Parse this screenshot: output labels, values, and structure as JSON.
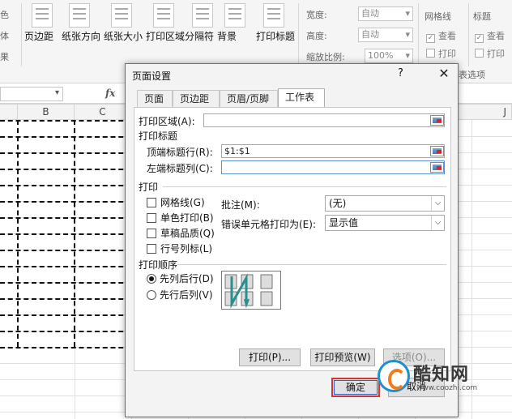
{
  "ribbon": {
    "left_partial": [
      "色",
      "体",
      "果"
    ],
    "buttons": [
      {
        "label": "页边距",
        "icon": "margins-icon"
      },
      {
        "label": "纸张方向",
        "icon": "orientation-icon"
      },
      {
        "label": "纸张大小",
        "icon": "paper-size-icon"
      },
      {
        "label": "打印区域",
        "icon": "print-area-icon"
      },
      {
        "label": "分隔符",
        "icon": "breaks-icon"
      },
      {
        "label": "背景",
        "icon": "background-icon"
      },
      {
        "label": "打印标题",
        "icon": "print-titles-icon"
      }
    ],
    "scale": {
      "width_label": "宽度:",
      "width_value": "自动",
      "height_label": "高度:",
      "height_value": "自动",
      "zoom_label": "缩放比例:",
      "zoom_value": "100%"
    },
    "gridlines": {
      "title": "网格线",
      "view": "查看",
      "print": "打印"
    },
    "headings": {
      "title": "标题",
      "view": "查看",
      "print": "打印"
    },
    "options_partial": "表选项"
  },
  "formula_bar": {
    "fx": "fx"
  },
  "columns": [
    "B",
    "C",
    "J"
  ],
  "dialog": {
    "title": "页面设置",
    "help": "?",
    "close": "✕",
    "tabs": [
      "页面",
      "页边距",
      "页眉/页脚",
      "工作表"
    ],
    "print_area_label": "打印区域(A):",
    "print_area_value": "",
    "print_titles_label": "打印标题",
    "rows_repeat_label": "顶端标题行(R):",
    "rows_repeat_value": "$1:$1",
    "cols_repeat_label": "左端标题列(C):",
    "cols_repeat_value": "",
    "print_section_label": "打印",
    "checkboxes": [
      "网格线(G)",
      "单色打印(B)",
      "草稿品质(Q)",
      "行号列标(L)"
    ],
    "comments_label": "批注(M):",
    "comments_value": "(无)",
    "errors_label": "错误单元格打印为(E):",
    "errors_value": "显示值",
    "order_label": "打印顺序",
    "order_options": [
      "先列后行(D)",
      "先行后列(V)"
    ],
    "buttons": {
      "print": "打印(P)...",
      "preview": "打印预览(W)",
      "options": "选项(O)...",
      "ok": "确定",
      "cancel": "取消"
    }
  },
  "watermark": {
    "name": "酷知网",
    "url": "www.coozhi.com"
  }
}
